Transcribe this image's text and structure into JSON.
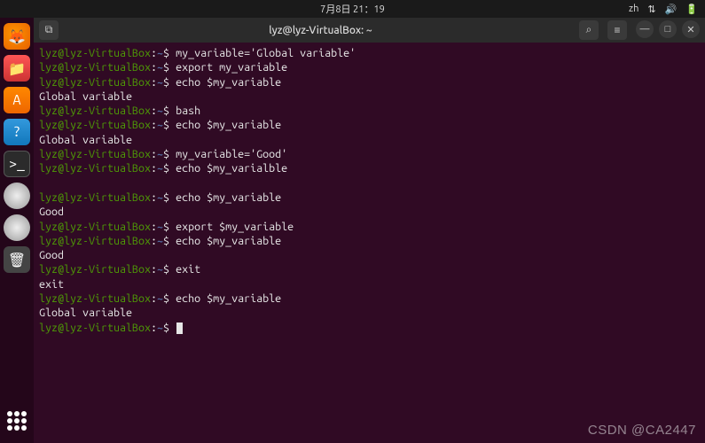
{
  "topbar": {
    "datetime": "7月8日 21：19",
    "lang": "zh"
  },
  "window": {
    "title": "lyz@lyz-VirtualBox: ~"
  },
  "prompt": {
    "user_host": "lyz@lyz-VirtualBox",
    "sep": ":",
    "path": "~",
    "dollar": "$"
  },
  "lines": [
    {
      "type": "cmd",
      "text": "my_variable='Global variable'"
    },
    {
      "type": "cmd",
      "text": "export my_variable"
    },
    {
      "type": "cmd",
      "text": "echo $my_variable"
    },
    {
      "type": "out",
      "text": "Global variable"
    },
    {
      "type": "cmd",
      "text": "bash"
    },
    {
      "type": "cmd",
      "text": "echo $my_variable"
    },
    {
      "type": "out",
      "text": "Global variable"
    },
    {
      "type": "cmd",
      "text": "my_variable='Good'"
    },
    {
      "type": "cmd",
      "text": "echo $my_varialble"
    },
    {
      "type": "out",
      "text": ""
    },
    {
      "type": "cmd",
      "text": "echo $my_variable"
    },
    {
      "type": "out",
      "text": "Good"
    },
    {
      "type": "cmd",
      "text": "export $my_variable"
    },
    {
      "type": "cmd",
      "text": "echo $my_variable"
    },
    {
      "type": "out",
      "text": "Good"
    },
    {
      "type": "cmd",
      "text": "exit"
    },
    {
      "type": "out",
      "text": "exit"
    },
    {
      "type": "cmd",
      "text": "echo $my_variable"
    },
    {
      "type": "out",
      "text": "Global variable"
    },
    {
      "type": "cursor"
    }
  ],
  "watermark": "CSDN @CA2447",
  "icons": {
    "newtab": "⧉",
    "search": "⌕",
    "menu": "≡",
    "min": "—",
    "max": "□",
    "close": "✕",
    "net": "⇅",
    "vol": "🔊",
    "bat": "🔋"
  }
}
